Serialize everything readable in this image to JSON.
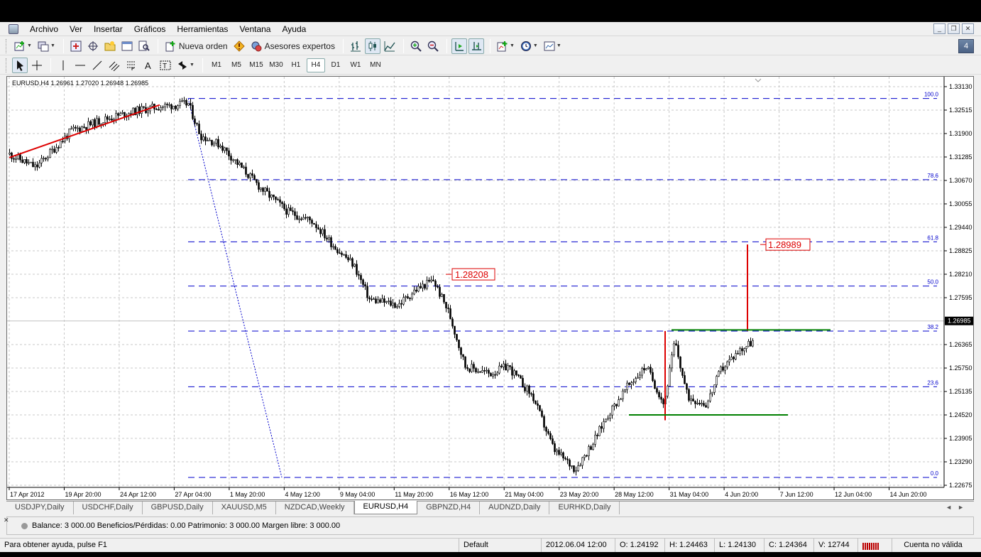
{
  "menu": {
    "items": [
      "Archivo",
      "Ver",
      "Insertar",
      "Gráficos",
      "Herramientas",
      "Ventana",
      "Ayuda"
    ]
  },
  "toolbar": {
    "new_order": "Nueva orden",
    "expert_advisors": "Asesores expertos",
    "timeframes": [
      "M1",
      "M5",
      "M15",
      "M30",
      "H1",
      "H4",
      "D1",
      "W1",
      "MN"
    ],
    "active_timeframe": "H4",
    "corner_badge": "4"
  },
  "chart": {
    "info": "EURUSD,H4  1.26961 1.27020 1.26948 1.26985",
    "current_price": "1.26985",
    "price_labels": [
      "1.33130",
      "1.32515",
      "1.31900",
      "1.31285",
      "1.30670",
      "1.30055",
      "1.29440",
      "1.28825",
      "1.28210",
      "1.27595",
      "1.26365",
      "1.25750",
      "1.25135",
      "1.24520",
      "1.23905",
      "1.23290",
      "1.22675"
    ],
    "time_labels": [
      "17 Apr 2012",
      "19 Apr 20:00",
      "24 Apr 12:00",
      "27 Apr 04:00",
      "1 May 20:00",
      "4 May 12:00",
      "9 May 04:00",
      "11 May 20:00",
      "16 May 12:00",
      "21 May 04:00",
      "23 May 20:00",
      "28 May 12:00",
      "31 May 04:00",
      "4 Jun 20:00",
      "7 Jun 12:00",
      "12 Jun 04:00",
      "14 Jun 20:00"
    ],
    "fib_levels": [
      "100.0",
      "78.6",
      "61.8",
      "50.0",
      "38.2",
      "23.6",
      "0.0"
    ],
    "annotations": {
      "price_a": "1.28208",
      "price_b": "1.28989"
    },
    "colors": {
      "trendline": "#dd0000",
      "fib": "#0000cc",
      "support": "#008000",
      "marker": "#dd0000"
    }
  },
  "chart_data": {
    "type": "candlestick",
    "title": "EURUSD,H4",
    "ylim": [
      1.2262,
      1.3339
    ],
    "grid": true,
    "fibonacci": [
      {
        "level": "100.0",
        "price": 1.3282
      },
      {
        "level": "78.6",
        "price": 1.3069
      },
      {
        "level": "61.8",
        "price": 1.2906
      },
      {
        "level": "50.0",
        "price": 1.279
      },
      {
        "level": "38.2",
        "price": 1.2672
      },
      {
        "level": "23.6",
        "price": 1.2526
      },
      {
        "level": "0.0",
        "price": 1.2288
      }
    ],
    "markers": [
      {
        "label": "1.28208",
        "price": 1.28208
      },
      {
        "label": "1.28989",
        "price": 1.28989
      }
    ]
  },
  "tabs": {
    "items": [
      "USDJPY,Daily",
      "USDCHF,Daily",
      "GBPUSD,Daily",
      "XAUUSD,M5",
      "NZDCAD,Weekly",
      "EURUSD,H4",
      "GBPNZD,H4",
      "AUDNZD,Daily",
      "EURHKD,Daily"
    ],
    "active_index": 5
  },
  "terminal": {
    "text": "Balance: 3 000.00  Beneficios/Pérdidas: 0.00  Patrimonio: 3 000.00  Margen libre: 3 000.00"
  },
  "status": {
    "help": "Para obtener ayuda, pulse F1",
    "profile": "Default",
    "datetime": "2012.06.04 12:00",
    "open": "O: 1.24192",
    "high": "H: 1.24463",
    "low": "L: 1.24130",
    "close": "C: 1.24364",
    "volume": "V: 12744",
    "account": "Cuenta no válida"
  }
}
